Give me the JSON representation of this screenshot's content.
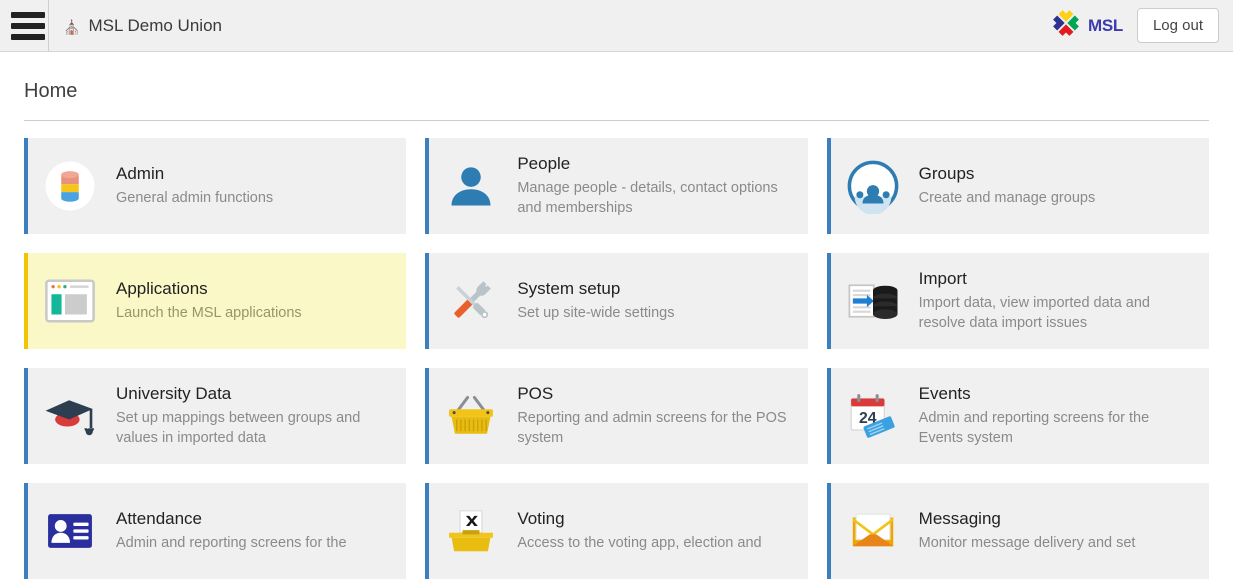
{
  "topbar": {
    "menu_icon": "hamburger-menu-icon",
    "home_icon": "home-icon",
    "site_name": "MSL Demo Union",
    "brand_text": "MSL",
    "brand_logo_icon": "msl-logo-icon",
    "logout_label": "Log out",
    "background": "#f0f0f0"
  },
  "page": {
    "title": "Home"
  },
  "theme": {
    "tile_background": "#f0f0f0",
    "tile_accent": "#3b7fbf",
    "highlight_background": "#fbf8c8",
    "highlight_accent": "#f2c500",
    "title_color": "#222222",
    "desc_color": "#8a8a8a"
  },
  "tiles": [
    {
      "title": "Admin",
      "desc": "General admin functions",
      "icon": "database-cylinder-icon",
      "highlighted": false
    },
    {
      "title": "People",
      "desc": "Manage people - details, contact options and memberships",
      "icon": "person-silhouette-icon",
      "highlighted": false
    },
    {
      "title": "Groups",
      "desc": "Create and manage groups",
      "icon": "group-circle-icon",
      "highlighted": false
    },
    {
      "title": "Applications",
      "desc": "Launch the MSL applications",
      "icon": "browser-window-icon",
      "highlighted": true
    },
    {
      "title": "System setup",
      "desc": "Set up site-wide settings",
      "icon": "wrench-screwdriver-icon",
      "highlighted": false
    },
    {
      "title": "Import",
      "desc": "Import data, view imported data and resolve data import issues",
      "icon": "document-import-database-icon",
      "highlighted": false
    },
    {
      "title": "University Data",
      "desc": "Set up mappings between groups and values in imported data",
      "icon": "graduation-cap-icon",
      "highlighted": false
    },
    {
      "title": "POS",
      "desc": "Reporting and admin screens for the POS system",
      "icon": "shopping-basket-icon",
      "highlighted": false
    },
    {
      "title": "Events",
      "desc": "Admin and reporting screens for the Events system",
      "icon": "calendar-ticket-icon",
      "calendar_day": "24",
      "highlighted": false
    },
    {
      "title": "Attendance",
      "desc": "Admin and reporting screens for the",
      "icon": "id-badge-icon",
      "highlighted": false
    },
    {
      "title": "Voting",
      "desc": "Access to the voting app, election and",
      "icon": "ballot-box-icon",
      "highlighted": false
    },
    {
      "title": "Messaging",
      "desc": "Monitor message delivery and set",
      "icon": "envelope-icon",
      "highlighted": false
    }
  ]
}
